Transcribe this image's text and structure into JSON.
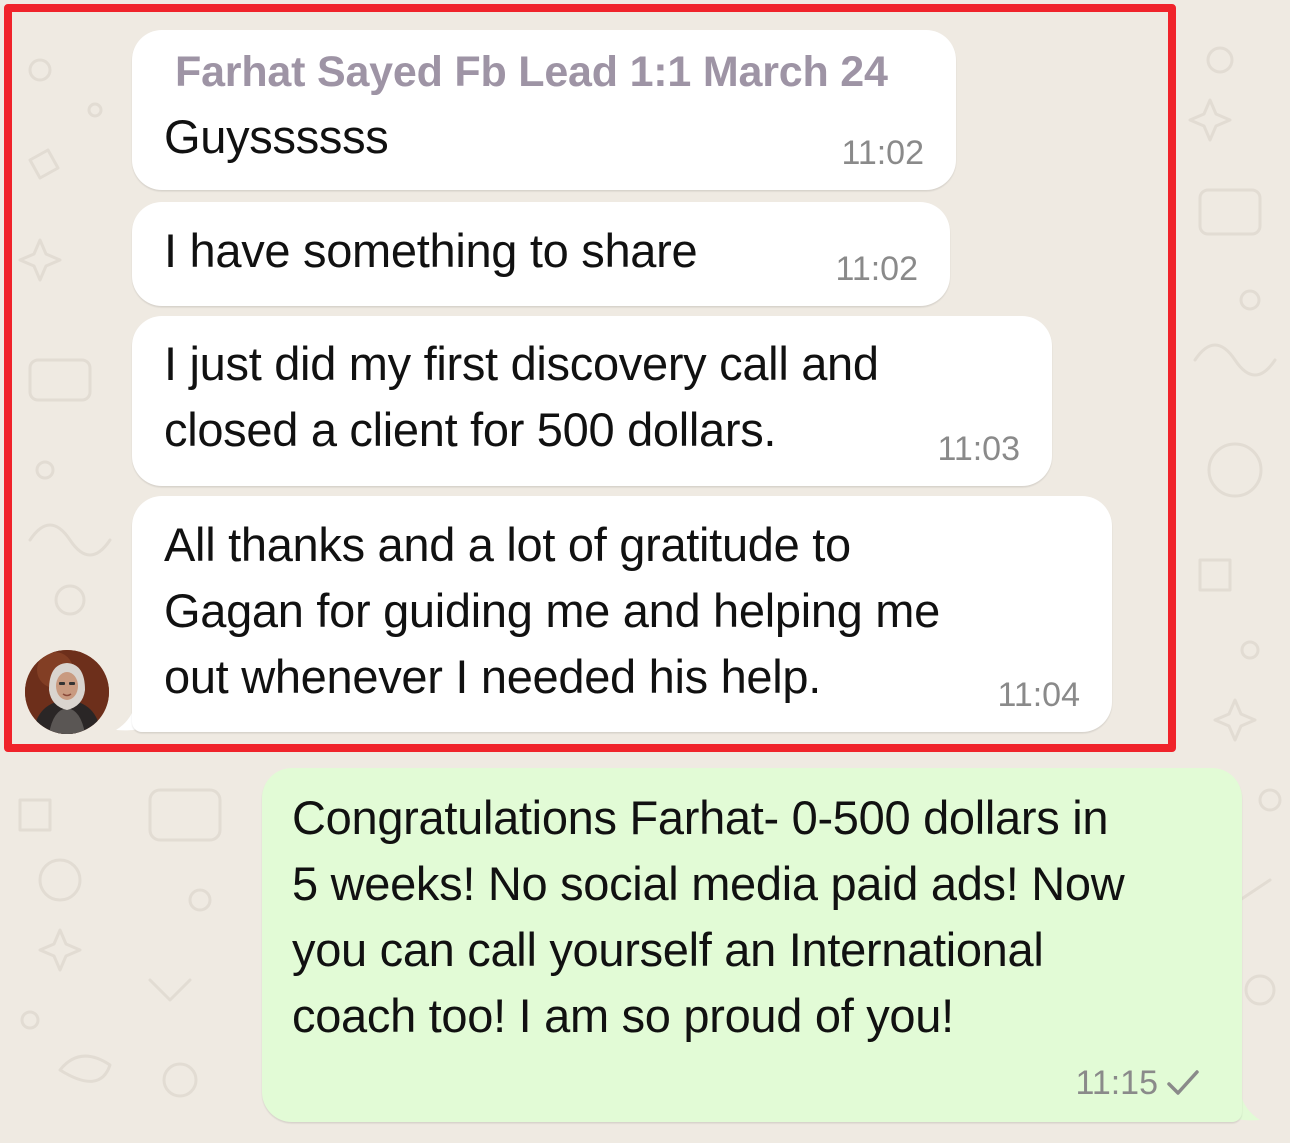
{
  "chat": {
    "incoming": [
      {
        "sender": "Farhat Sayed Fb Lead 1:1 March 24",
        "lines": [
          "Guyssssss"
        ],
        "time": "11:02"
      },
      {
        "lines": [
          "I have something to share"
        ],
        "time": "11:02"
      },
      {
        "lines": [
          "I just did my first discovery call and",
          "closed a client for 500 dollars."
        ],
        "time": "11:03"
      },
      {
        "lines": [
          "All thanks and a lot of gratitude to",
          "Gagan for guiding me and helping me",
          "out whenever I needed his help."
        ],
        "time": "11:04"
      }
    ],
    "outgoing": [
      {
        "lines": [
          "Congratulations Farhat- 0-500 dollars in",
          "5 weeks! No social media paid ads! Now",
          "you can call yourself an International",
          "coach too! I am so proud of you!"
        ],
        "time": "11:15",
        "status_icon": "single-check-icon"
      }
    ]
  },
  "avatar_icon": "sender-avatar",
  "colors": {
    "background": "#efeae2",
    "incoming_bubble": "#ffffff",
    "outgoing_bubble": "#e2fbd6",
    "sender_name": "#9e94a5",
    "highlight_frame": "#f0232a",
    "timestamp": "#8a8a8a"
  }
}
